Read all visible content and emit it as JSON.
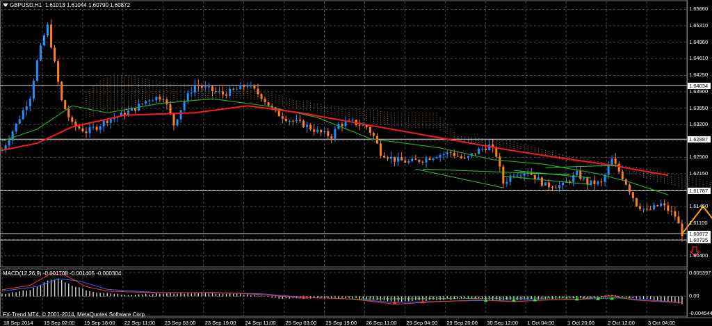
{
  "header": {
    "symbol": "GBPUSD,H1",
    "ohlc": "1.61013 1.61044 1.60790 1.60872"
  },
  "macd_header": "MACD(12,26,9) -0.001708 -0.001405 -0.000304",
  "copyright": "FX-Trend MT4, © 2001-2014, MetaQuotes Software Corp.",
  "colors": {
    "background": "#000000",
    "grid": "#4a4a4a",
    "bull": "#1e90ff",
    "bear": "#ff7f27",
    "ma_red": "#ff1a1a",
    "ma_green": "#22aa22",
    "ichimoku_a": "#d2a582",
    "ichimoku_b": "#d0d0d0",
    "projection": "#ffa500",
    "sell_arrow": "#ff2020",
    "macd_line": "#ff3333",
    "macd_signal": "#3366ff"
  },
  "chart_data": {
    "type": "candlestick",
    "price_axis": {
      "labels": [
        "1.65660",
        "1.65310",
        "1.64960",
        "1.64610",
        "1.64250",
        "1.63900",
        "1.63550",
        "1.63200",
        "1.62850",
        "1.62500",
        "1.62150",
        "1.61800",
        "1.61450",
        "1.61100",
        "1.60750",
        "1.60400"
      ],
      "range": [
        1.6016,
        1.6583
      ]
    },
    "price_tags": [
      "1.64034",
      "1.62887",
      "1.61787",
      "1.60872",
      "1.60735"
    ],
    "horizontal_levels": [
      1.64034,
      1.62887,
      1.61787,
      1.6087,
      1.60735
    ],
    "time_axis": [
      "18 Sep 2014",
      "19 Sep 02:00",
      "19 Sep 18:00",
      "22 Sep 11:00",
      "23 Sep 03:00",
      "23 Sep 19:00",
      "24 Sep 11:00",
      "25 Sep 03:00",
      "25 Sep 19:00",
      "26 Sep 11:00",
      "29 Sep 04:00",
      "29 Sep 20:00",
      "30 Sep 12:00",
      "1 Oct 04:00",
      "1 Oct 20:00",
      "2 Oct 12:00",
      "3 Oct 04:00"
    ],
    "bar_count": 195,
    "close_path": [
      [
        0,
        1.6265
      ],
      [
        4,
        1.632
      ],
      [
        8,
        1.638
      ],
      [
        10,
        1.6455
      ],
      [
        12,
        1.651
      ],
      [
        13,
        1.653
      ],
      [
        15,
        1.645
      ],
      [
        17,
        1.637
      ],
      [
        20,
        1.632
      ],
      [
        24,
        1.6305
      ],
      [
        27,
        1.6315
      ],
      [
        30,
        1.633
      ],
      [
        34,
        1.634
      ],
      [
        38,
        1.6355
      ],
      [
        42,
        1.6375
      ],
      [
        46,
        1.638
      ],
      [
        49,
        1.632
      ],
      [
        52,
        1.637
      ],
      [
        55,
        1.6405
      ],
      [
        59,
        1.6395
      ],
      [
        63,
        1.6385
      ],
      [
        67,
        1.6395
      ],
      [
        70,
        1.6405
      ],
      [
        74,
        1.638
      ],
      [
        78,
        1.6345
      ],
      [
        82,
        1.633
      ],
      [
        86,
        1.632
      ],
      [
        90,
        1.6305
      ],
      [
        94,
        1.6295
      ],
      [
        96,
        1.632
      ],
      [
        100,
        1.6325
      ],
      [
        104,
        1.6315
      ],
      [
        106,
        1.6295
      ],
      [
        108,
        1.626
      ],
      [
        112,
        1.6245
      ],
      [
        116,
        1.624
      ],
      [
        120,
        1.6245
      ],
      [
        124,
        1.6255
      ],
      [
        128,
        1.626
      ],
      [
        132,
        1.6245
      ],
      [
        136,
        1.6265
      ],
      [
        139,
        1.6275
      ],
      [
        141,
        1.6255
      ],
      [
        143,
        1.6195
      ],
      [
        146,
        1.6215
      ],
      [
        150,
        1.622
      ],
      [
        155,
        1.619
      ],
      [
        160,
        1.619
      ],
      [
        164,
        1.6215
      ],
      [
        167,
        1.6195
      ],
      [
        171,
        1.6195
      ],
      [
        174,
        1.6245
      ],
      [
        176,
        1.622
      ],
      [
        178,
        1.6195
      ],
      [
        181,
        1.615
      ],
      [
        184,
        1.6135
      ],
      [
        188,
        1.615
      ],
      [
        192,
        1.6125
      ],
      [
        194,
        1.6087
      ]
    ],
    "ma_red_path": [
      [
        0,
        1.6265
      ],
      [
        10,
        1.628
      ],
      [
        20,
        1.6315
      ],
      [
        35,
        1.634
      ],
      [
        55,
        1.6345
      ],
      [
        70,
        1.636
      ],
      [
        85,
        1.6345
      ],
      [
        100,
        1.6325
      ],
      [
        115,
        1.6305
      ],
      [
        130,
        1.6285
      ],
      [
        145,
        1.6265
      ],
      [
        160,
        1.6248
      ],
      [
        175,
        1.6232
      ],
      [
        185,
        1.6218
      ],
      [
        190,
        1.6212
      ]
    ],
    "ma_green_path": [
      [
        0,
        1.6285
      ],
      [
        10,
        1.631
      ],
      [
        20,
        1.636
      ],
      [
        30,
        1.6345
      ],
      [
        45,
        1.6365
      ],
      [
        60,
        1.6375
      ],
      [
        75,
        1.636
      ],
      [
        90,
        1.6335
      ],
      [
        105,
        1.629
      ],
      [
        125,
        1.627
      ],
      [
        140,
        1.6245
      ],
      [
        155,
        1.6235
      ],
      [
        170,
        1.6215
      ],
      [
        180,
        1.6195
      ],
      [
        190,
        1.617
      ]
    ],
    "ichimoku_upper_path": [
      [
        24,
        1.639
      ],
      [
        30,
        1.6425
      ],
      [
        36,
        1.6425
      ],
      [
        42,
        1.6415
      ],
      [
        54,
        1.6405
      ],
      [
        70,
        1.6405
      ],
      [
        84,
        1.637
      ],
      [
        100,
        1.6355
      ],
      [
        112,
        1.6345
      ],
      [
        124,
        1.6345
      ],
      [
        130,
        1.6295
      ],
      [
        145,
        1.6285
      ],
      [
        160,
        1.6255
      ],
      [
        175,
        1.6235
      ],
      [
        188,
        1.622
      ],
      [
        198,
        1.6205
      ],
      [
        208,
        1.6185
      ],
      [
        212,
        1.616
      ]
    ],
    "ichimoku_lower_path": [
      [
        24,
        1.6335
      ],
      [
        30,
        1.6345
      ],
      [
        40,
        1.636
      ],
      [
        54,
        1.637
      ],
      [
        70,
        1.6375
      ],
      [
        84,
        1.6355
      ],
      [
        100,
        1.633
      ],
      [
        112,
        1.6315
      ],
      [
        124,
        1.631
      ],
      [
        130,
        1.6285
      ],
      [
        145,
        1.627
      ],
      [
        160,
        1.6245
      ],
      [
        175,
        1.6225
      ],
      [
        188,
        1.6195
      ],
      [
        198,
        1.6175
      ],
      [
        208,
        1.6165
      ],
      [
        212,
        1.615
      ]
    ],
    "trendlines": [
      [
        [
          118,
          1.6225
        ],
        [
          143,
          1.6185
        ]
      ],
      [
        [
          120,
          1.6225
        ],
        [
          162,
          1.6213
        ]
      ],
      [
        [
          143,
          1.621
        ],
        [
          168,
          1.6192
        ]
      ],
      [
        [
          146,
          1.6222
        ],
        [
          168,
          1.6206
        ]
      ],
      [
        [
          155,
          1.6228
        ],
        [
          176,
          1.6233
        ]
      ]
    ],
    "projection_path": [
      [
        194,
        1.6087
      ],
      [
        200,
        1.6145
      ],
      [
        206,
        1.6087
      ]
    ],
    "sell_arrow": {
      "bar": 196,
      "price": 1.6044
    },
    "macd": {
      "range": [
        -0.0045,
        0.0062
      ],
      "axis_labels": [
        "0.005397",
        "0.00",
        "-0.004544"
      ],
      "histogram_path": [
        [
          0,
          0.0005
        ],
        [
          8,
          0.0015
        ],
        [
          13,
          0.0035
        ],
        [
          16,
          0.004
        ],
        [
          20,
          0.0025
        ],
        [
          26,
          0.001
        ],
        [
          34,
          0.0004
        ],
        [
          44,
          0.0006
        ],
        [
          56,
          0.0008
        ],
        [
          70,
          0.0004
        ],
        [
          80,
          -0.0005
        ],
        [
          90,
          -0.0004
        ],
        [
          100,
          -0.0004
        ],
        [
          112,
          -0.0012
        ],
        [
          124,
          -0.0008
        ],
        [
          134,
          -0.0004
        ],
        [
          142,
          -0.0008
        ],
        [
          150,
          -0.0006
        ],
        [
          160,
          -0.0005
        ],
        [
          168,
          -0.0004
        ],
        [
          174,
          0.0004
        ],
        [
          180,
          -0.0004
        ],
        [
          186,
          -0.0008
        ],
        [
          194,
          -0.0017
        ]
      ],
      "line_path": [
        [
          0,
          0.0015
        ],
        [
          8,
          0.0025
        ],
        [
          14,
          0.0052
        ],
        [
          18,
          0.0048
        ],
        [
          24,
          0.0022
        ],
        [
          30,
          0.0012
        ],
        [
          44,
          0.0008
        ],
        [
          60,
          0.0009
        ],
        [
          72,
          0.0005
        ],
        [
          84,
          -0.0002
        ],
        [
          100,
          -0.0006
        ],
        [
          112,
          -0.0018
        ],
        [
          124,
          -0.0012
        ],
        [
          136,
          -0.0008
        ],
        [
          146,
          -0.0012
        ],
        [
          156,
          -0.0008
        ],
        [
          166,
          -0.0006
        ],
        [
          174,
          0.0002
        ],
        [
          180,
          -0.0008
        ],
        [
          188,
          -0.0012
        ],
        [
          194,
          -0.0014
        ]
      ],
      "signal_path": [
        [
          0,
          0.0012
        ],
        [
          10,
          0.0022
        ],
        [
          16,
          0.004
        ],
        [
          22,
          0.0035
        ],
        [
          30,
          0.0016
        ],
        [
          44,
          0.0009
        ],
        [
          60,
          0.0008
        ],
        [
          74,
          0.0006
        ],
        [
          86,
          -0.0002
        ],
        [
          100,
          -0.0006
        ],
        [
          112,
          -0.0014
        ],
        [
          126,
          -0.0011
        ],
        [
          140,
          -0.0009
        ],
        [
          152,
          -0.0008
        ],
        [
          166,
          -0.0006
        ],
        [
          176,
          -0.0004
        ],
        [
          186,
          -0.0009
        ],
        [
          194,
          -0.0014
        ]
      ],
      "signal_markers": [
        86,
        112,
        120,
        138,
        146,
        152,
        164,
        170,
        174
      ]
    }
  }
}
